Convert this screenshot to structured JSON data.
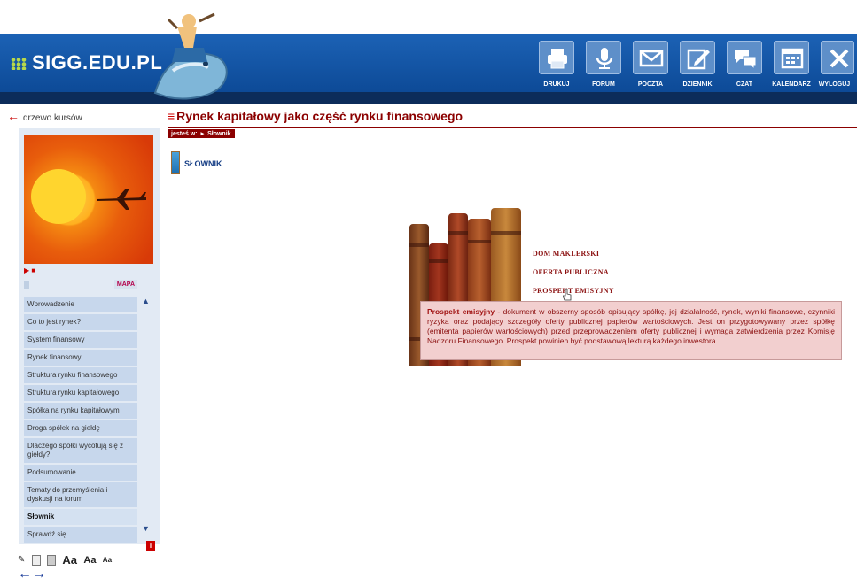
{
  "header": {
    "logo": "SIGG.EDU.PL",
    "tools": [
      {
        "label": "DRUKUJ",
        "icon": "printer-icon"
      },
      {
        "label": "FORUM",
        "icon": "microphone-icon"
      },
      {
        "label": "POCZTA",
        "icon": "envelope-icon"
      },
      {
        "label": "DZIENNIK",
        "icon": "notebook-pencil-icon"
      },
      {
        "label": "CZAT",
        "icon": "chat-bubbles-icon"
      },
      {
        "label": "KALENDARZ",
        "icon": "calendar-icon"
      },
      {
        "label": "WYLOGUJ",
        "icon": "close-x-icon"
      }
    ]
  },
  "sidebar": {
    "back_link": "drzewo kursów",
    "mapa": "MAPA",
    "lessons": [
      {
        "label": "Wprowadzenie",
        "active": false
      },
      {
        "label": "Co to jest rynek?",
        "active": false
      },
      {
        "label": "System finansowy",
        "active": false
      },
      {
        "label": "Rynek finansowy",
        "active": false
      },
      {
        "label": "Struktura rynku finansowego",
        "active": false
      },
      {
        "label": "Struktura rynku kapitałowego",
        "active": false
      },
      {
        "label": "Spółka na rynku kapitałowym",
        "active": false
      },
      {
        "label": "Droga spółek na giełdę",
        "active": false
      },
      {
        "label": "Dlaczego spółki wycofują się z giełdy?",
        "active": false
      },
      {
        "label": "Podsumowanie",
        "active": false
      },
      {
        "label": "Tematy do przemyślenia i dyskusji na forum",
        "active": false
      },
      {
        "label": "Słownik",
        "active": true
      },
      {
        "label": "Sprawdź się",
        "active": false
      }
    ],
    "font_sizes": [
      "Aa",
      "Aa",
      "Aa"
    ]
  },
  "main": {
    "title": "Rynek kapitałowy jako część rynku finansowego",
    "breadcrumb_prefix": "jesteś w:",
    "breadcrumb_current": "Słownik",
    "section_label": "SŁOWNIK",
    "glossary": [
      "DOM MAKLERSKI",
      "OFERTA PUBLICZNA",
      "PROSPEKT EMISYJNY"
    ],
    "tooltip": {
      "term": "Prospekt emisyjny",
      "definition": " - dokument w obszerny sposób opisujący spółkę, jej działalność, rynek, wyniki finansowe, czynniki ryzyka oraz podający szczegóły oferty publicznej papierów wartościowych. Jest on przygotowywany przez spółkę (emitenta papierów wartościowych) przed przeprowadzeniem oferty publicznej i wymaga zatwierdzenia przez Komisję Nadzoru Finansowego. Prospekt powinien być podstawową lekturą każdego inwestora."
    }
  },
  "colors": {
    "header_blue": "#1c62b5",
    "title_red": "#8b0000",
    "tooltip_bg": "#f2cfcf",
    "sidebar_bg": "#e2eaf4"
  }
}
